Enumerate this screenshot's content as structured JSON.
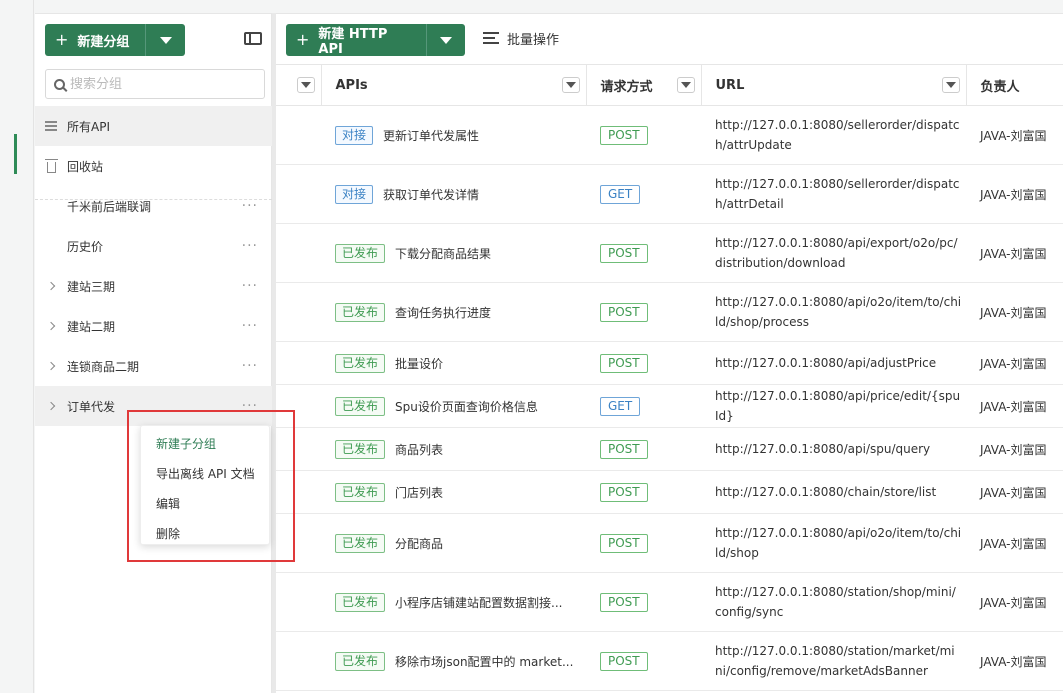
{
  "sidebar": {
    "new_group_label": "新建分组",
    "search_placeholder": "搜索分组",
    "items": [
      {
        "label": "所有API"
      },
      {
        "label": "回收站"
      },
      {
        "label": "千米前后端联调"
      },
      {
        "label": "历史价"
      },
      {
        "label": "建站三期"
      },
      {
        "label": "建站二期"
      },
      {
        "label": "连锁商品二期"
      },
      {
        "label": "订单代发"
      }
    ],
    "more_glyph": "···"
  },
  "context_menu": {
    "items": [
      "新建子分组",
      "导出离线 API 文档",
      "编辑",
      "删除"
    ]
  },
  "toolbar": {
    "new_api_label": "新建 HTTP API",
    "batch_label": "批量操作"
  },
  "table": {
    "headers": [
      "APIs",
      "请求方式",
      "URL",
      "负责人"
    ],
    "rows": [
      {
        "status": "对接",
        "name": "更新订单代发属性",
        "method": "POST",
        "url": "http://127.0.0.1:8080/sellerorder/dispatch/attrUpdate",
        "owner": "JAVA-刘富国"
      },
      {
        "status": "对接",
        "name": "获取订单代发详情",
        "method": "GET",
        "url": "http://127.0.0.1:8080/sellerorder/dispatch/attrDetail",
        "owner": "JAVA-刘富国"
      },
      {
        "status": "已发布",
        "name": "下载分配商品结果",
        "method": "POST",
        "url": "http://127.0.0.1:8080/api/export/o2o/pc/distribution/download",
        "owner": "JAVA-刘富国"
      },
      {
        "status": "已发布",
        "name": "查询任务执行进度",
        "method": "POST",
        "url": "http://127.0.0.1:8080/api/o2o/item/to/child/shop/process",
        "owner": "JAVA-刘富国"
      },
      {
        "status": "已发布",
        "name": "批量设价",
        "method": "POST",
        "url": "http://127.0.0.1:8080/api/adjustPrice",
        "owner": "JAVA-刘富国"
      },
      {
        "status": "已发布",
        "name": "Spu设价页面查询价格信息",
        "method": "GET",
        "url": "http://127.0.0.1:8080/api/price/edit/{spuId}",
        "owner": "JAVA-刘富国"
      },
      {
        "status": "已发布",
        "name": "商品列表",
        "method": "POST",
        "url": "http://127.0.0.1:8080/api/spu/query",
        "owner": "JAVA-刘富国"
      },
      {
        "status": "已发布",
        "name": "门店列表",
        "method": "POST",
        "url": "http://127.0.0.1:8080/chain/store/list",
        "owner": "JAVA-刘富国"
      },
      {
        "status": "已发布",
        "name": "分配商品",
        "method": "POST",
        "url": "http://127.0.0.1:8080/api/o2o/item/to/child/shop",
        "owner": "JAVA-刘富国"
      },
      {
        "status": "已发布",
        "name": "小程序店铺建站配置数据割接...",
        "method": "POST",
        "url": "http://127.0.0.1:8080/station/shop/mini/config/sync",
        "owner": "JAVA-刘富国"
      },
      {
        "status": "已发布",
        "name": "移除市场json配置中的 market...",
        "method": "POST",
        "url": "http://127.0.0.1:8080/station/market/mini/config/remove/marketAdsBanner",
        "owner": "JAVA-刘富国"
      }
    ]
  },
  "colors": {
    "brand_green": "#2f7d55",
    "highlight_red": "#e0393a",
    "tag_blue": "#3b82c4",
    "tag_green": "#3f9b52"
  }
}
